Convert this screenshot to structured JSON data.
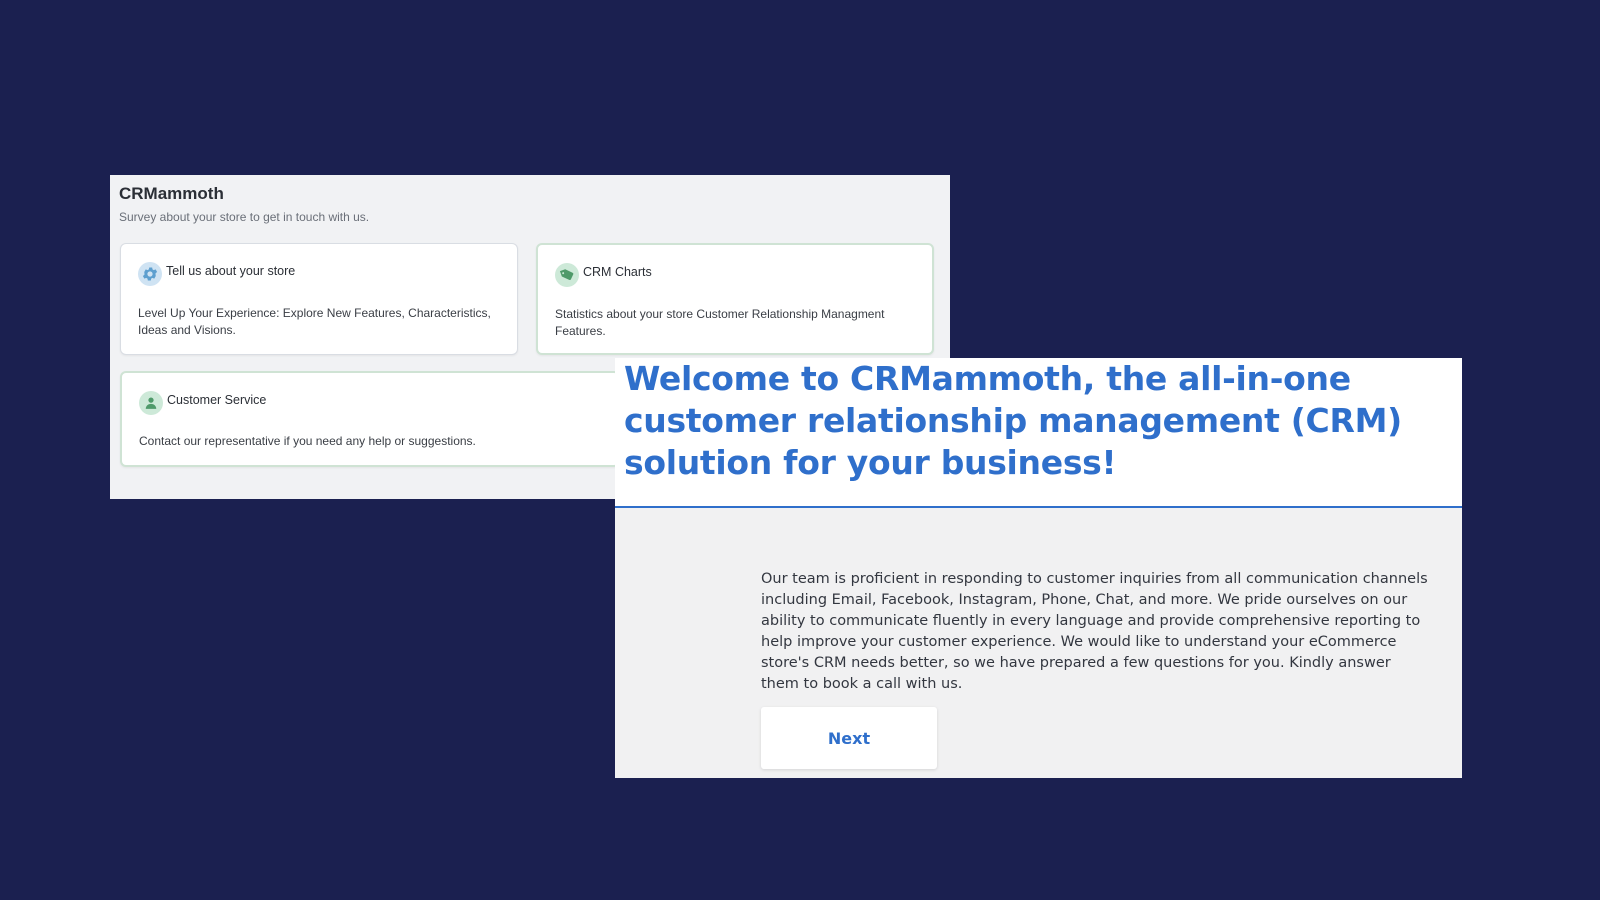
{
  "survey": {
    "app_title": "CRMammoth",
    "subtitle": "Survey about your store to get in touch with us.",
    "cards": [
      {
        "title": "Tell us about your store",
        "description": "Level Up Your Experience: Explore New Features, Characteristics, Ideas and Visions.",
        "icon": "gear-icon"
      },
      {
        "title": "CRM Charts",
        "description": "Statistics about your store Customer Relationship Managment Features.",
        "icon": "tag-icon"
      },
      {
        "title": "Customer Service",
        "description": "Contact our representative if you need any help or suggestions.",
        "icon": "person-icon"
      }
    ]
  },
  "welcome": {
    "heading": "Welcome to CRMammoth, the all-in-one customer relationship management (CRM) solution for your business!",
    "body": "Our team is proficient in responding to customer inquiries from all communication channels including Email, Facebook, Instagram, Phone, Chat, and more. We pride ourselves on our ability to communicate fluently in every language and provide comprehensive reporting to help improve your customer experience. We would like to understand your eCommerce store's CRM needs better, so we have prepared a few questions for you. Kindly answer them to book a call with us.",
    "next_label": "Next"
  },
  "colors": {
    "page_background": "#1b2050",
    "accent_blue": "#2f6fcb",
    "card_border_green": "#cfe3d4"
  }
}
